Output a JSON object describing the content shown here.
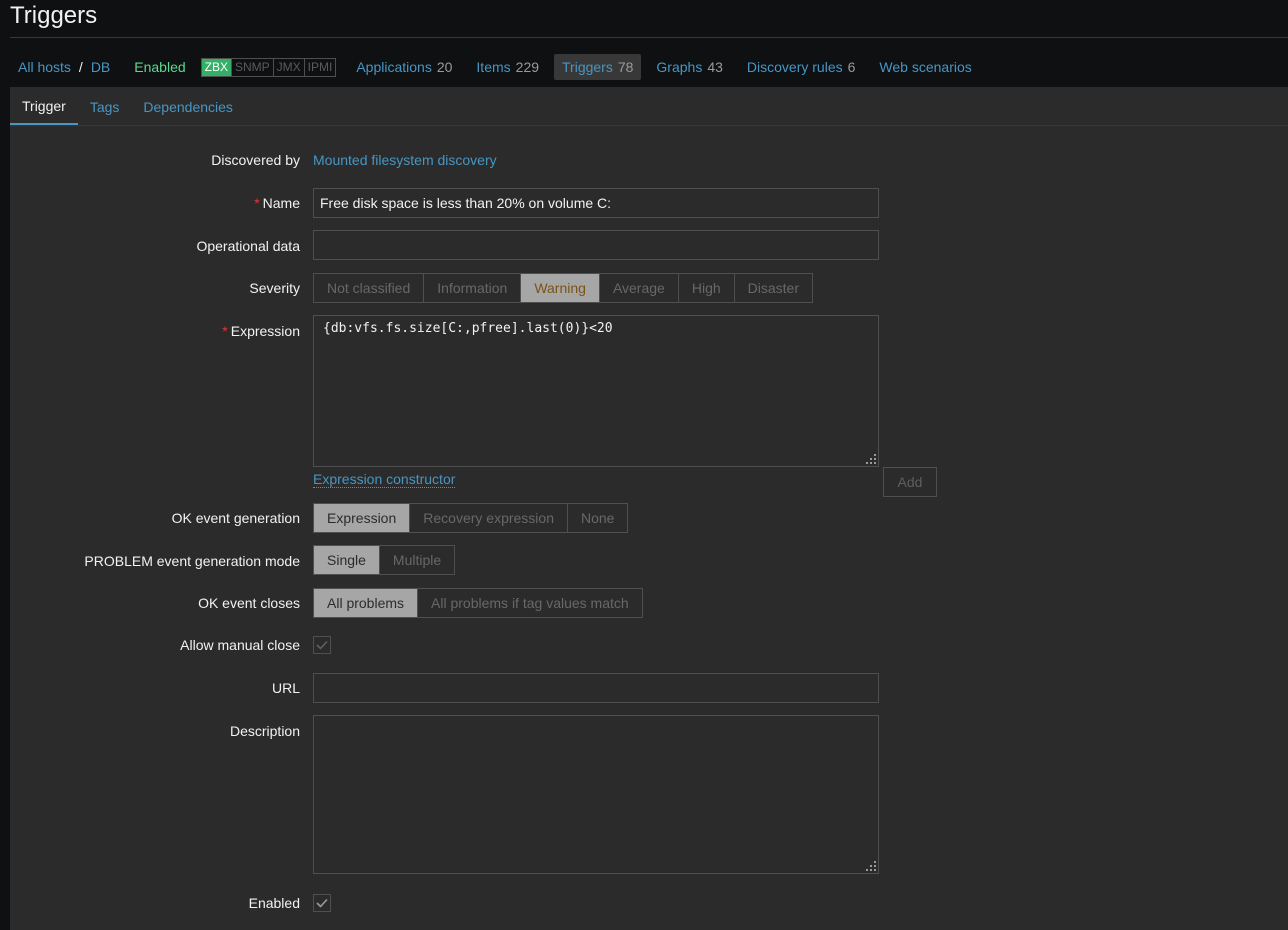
{
  "page": {
    "title": "Triggers"
  },
  "hostnav": {
    "all_hosts": "All hosts",
    "separator": "/",
    "host": "DB",
    "status": "Enabled",
    "availability": [
      "ZBX",
      "SNMP",
      "JMX",
      "IPMI"
    ],
    "links": [
      {
        "label": "Applications",
        "count": "20"
      },
      {
        "label": "Items",
        "count": "229"
      },
      {
        "label": "Triggers",
        "count": "78"
      },
      {
        "label": "Graphs",
        "count": "43"
      },
      {
        "label": "Discovery rules",
        "count": "6"
      },
      {
        "label": "Web scenarios",
        "count": ""
      }
    ]
  },
  "tabs": [
    "Trigger",
    "Tags",
    "Dependencies"
  ],
  "form": {
    "discovered_by": {
      "label": "Discovered by",
      "value": "Mounted filesystem discovery"
    },
    "name": {
      "label": "Name",
      "value": "Free disk space is less than 20% on volume C:"
    },
    "operational_data": {
      "label": "Operational data",
      "value": ""
    },
    "severity": {
      "label": "Severity",
      "options": [
        "Not classified",
        "Information",
        "Warning",
        "Average",
        "High",
        "Disaster"
      ],
      "selected": "Warning"
    },
    "expression": {
      "label": "Expression",
      "value": "{db:vfs.fs.size[C:,pfree].last(0)}<20",
      "add_label": "Add",
      "constructor_link": "Expression constructor"
    },
    "ok_event_generation": {
      "label": "OK event generation",
      "options": [
        "Expression",
        "Recovery expression",
        "None"
      ],
      "selected": "Expression"
    },
    "problem_mode": {
      "label": "PROBLEM event generation mode",
      "options": [
        "Single",
        "Multiple"
      ],
      "selected": "Single"
    },
    "ok_event_closes": {
      "label": "OK event closes",
      "options": [
        "All problems",
        "All problems if tag values match"
      ],
      "selected": "All problems"
    },
    "allow_manual_close": {
      "label": "Allow manual close",
      "checked": true
    },
    "url": {
      "label": "URL",
      "value": ""
    },
    "description": {
      "label": "Description",
      "value": ""
    },
    "enabled": {
      "label": "Enabled",
      "checked": true
    }
  },
  "colors": {
    "background": "#2b2b2b",
    "link": "#4796c4",
    "enabled_green": "#59db8f",
    "zbx_badge": "#34af67",
    "required_star": "#e33734"
  }
}
